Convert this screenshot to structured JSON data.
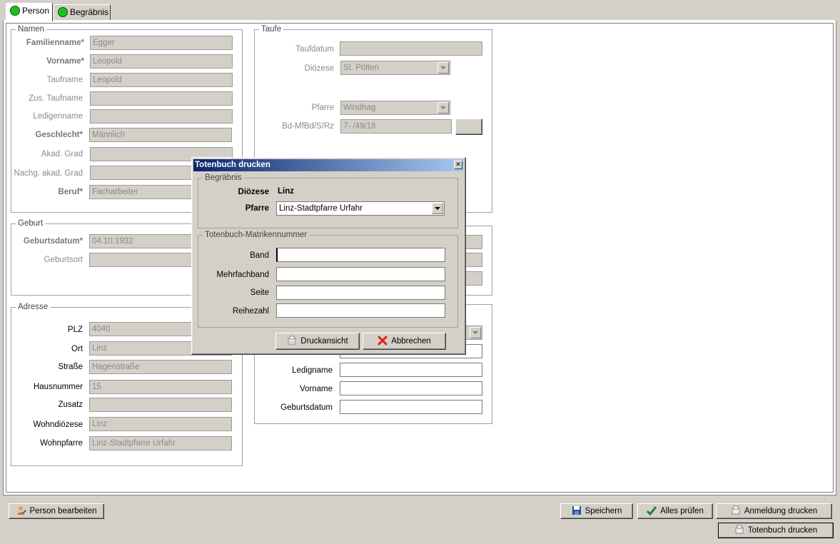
{
  "tabs": [
    {
      "label": "Person",
      "status_color": "#1ec01e"
    },
    {
      "label": "Begräbnis",
      "status_color": "#1ec01e"
    }
  ],
  "namen": {
    "legend": "Namen",
    "familienname": {
      "label": "Familienname*",
      "value": "Egger"
    },
    "vorname": {
      "label": "Vorname*",
      "value": "Leopold"
    },
    "taufname": {
      "label": "Taufname",
      "value": "Leopold"
    },
    "zus_taufname": {
      "label": "Zus. Taufname",
      "value": ""
    },
    "ledigenname": {
      "label": "Ledigenname",
      "value": ""
    },
    "geschlecht": {
      "label": "Geschlecht*",
      "value": "Männlich"
    },
    "akad_grad": {
      "label": "Akad. Grad",
      "value": ""
    },
    "nachg_akad_grad": {
      "label": "Nachg. akad. Grad",
      "value": ""
    },
    "beruf": {
      "label": "Beruf*",
      "value": "Facharbeiter"
    }
  },
  "taufe": {
    "legend": "Taufe",
    "taufdatum": {
      "label": "Taufdatum",
      "value": ""
    },
    "dioezese": {
      "label": "Diözese",
      "value": "St. Pölten"
    },
    "pfarre": {
      "label": "Pfarre",
      "value": "Windhag"
    },
    "bd": {
      "label": "Bd-MfBd/S/Rz",
      "value": "7- /49/18"
    }
  },
  "geburt": {
    "legend": "Geburt",
    "geburtsdatum": {
      "label": "Geburtsdatum*",
      "value": "04.10.1932"
    },
    "geburtsort": {
      "label": "Geburtsort",
      "value": ""
    }
  },
  "adresse": {
    "legend": "Adresse",
    "plz": {
      "label": "PLZ",
      "value": "4040"
    },
    "ort": {
      "label": "Ort",
      "value": "Linz"
    },
    "strasse": {
      "label": "Straße",
      "value": "Hagenstraße"
    },
    "hausnummer": {
      "label": "Hausnummer",
      "value": "15"
    },
    "zusatz": {
      "label": "Zusatz",
      "value": ""
    },
    "wohndioezese": {
      "label": "Wohndiözese",
      "value": "Linz"
    },
    "wohnpfarre": {
      "label": "Wohnpfarre",
      "value": "Linz-Stadtpfarre Urfahr"
    }
  },
  "rechts_unten": {
    "ledigname": {
      "label": "Ledigname",
      "value": ""
    },
    "vorname": {
      "label": "Vorname",
      "value": ""
    },
    "geburtsdatum": {
      "label": "Geburtsdatum",
      "value": ""
    }
  },
  "dialog": {
    "title": "Totenbuch drucken",
    "close_glyph": "✕",
    "begraebnis_legend": "Begräbnis",
    "dioezese_label": "Diözese",
    "dioezese_value": "Linz",
    "pfarre_label": "Pfarre",
    "pfarre_value": "Linz-Stadtpfarre Urfahr",
    "matrikel_legend": "Totenbuch-Matrikennummer",
    "band_label": "Band",
    "band_value": "",
    "mehrfachband_label": "Mehrfachband",
    "mehrfachband_value": "",
    "seite_label": "Seite",
    "seite_value": "",
    "reihezahl_label": "Reihezahl",
    "reihezahl_value": "",
    "druckansicht_label": "Druckansicht",
    "abbrechen_label": "Abbrechen"
  },
  "footer": {
    "person_bearbeiten": "Person bearbeiten",
    "speichern": "Speichern",
    "alles_pruefen": "Alles prüfen",
    "anmeldung_drucken": "Anmeldung drucken",
    "totenbuch_drucken": "Totenbuch drucken"
  }
}
